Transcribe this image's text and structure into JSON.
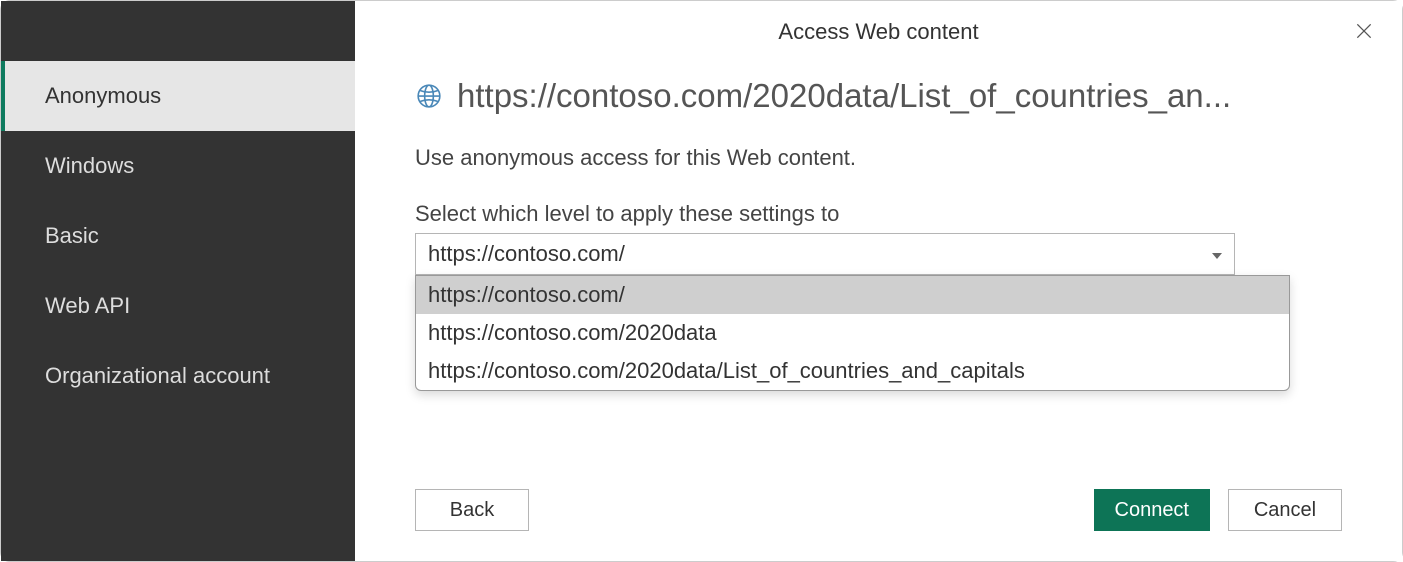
{
  "dialog": {
    "title": "Access Web content"
  },
  "sidebar": {
    "items": [
      {
        "label": "Anonymous",
        "active": true
      },
      {
        "label": "Windows",
        "active": false
      },
      {
        "label": "Basic",
        "active": false
      },
      {
        "label": "Web API",
        "active": false
      },
      {
        "label": "Organizational account",
        "active": false
      }
    ]
  },
  "main": {
    "url": "https://contoso.com/2020data/List_of_countries_an...",
    "description": "Use anonymous access for this Web content.",
    "select_label": "Select which level to apply these settings to",
    "selected_value": "https://contoso.com/",
    "dropdown_options": [
      "https://contoso.com/",
      "https://contoso.com/2020data",
      "https://contoso.com/2020data/List_of_countries_and_capitals"
    ]
  },
  "buttons": {
    "back": "Back",
    "connect": "Connect",
    "cancel": "Cancel"
  }
}
